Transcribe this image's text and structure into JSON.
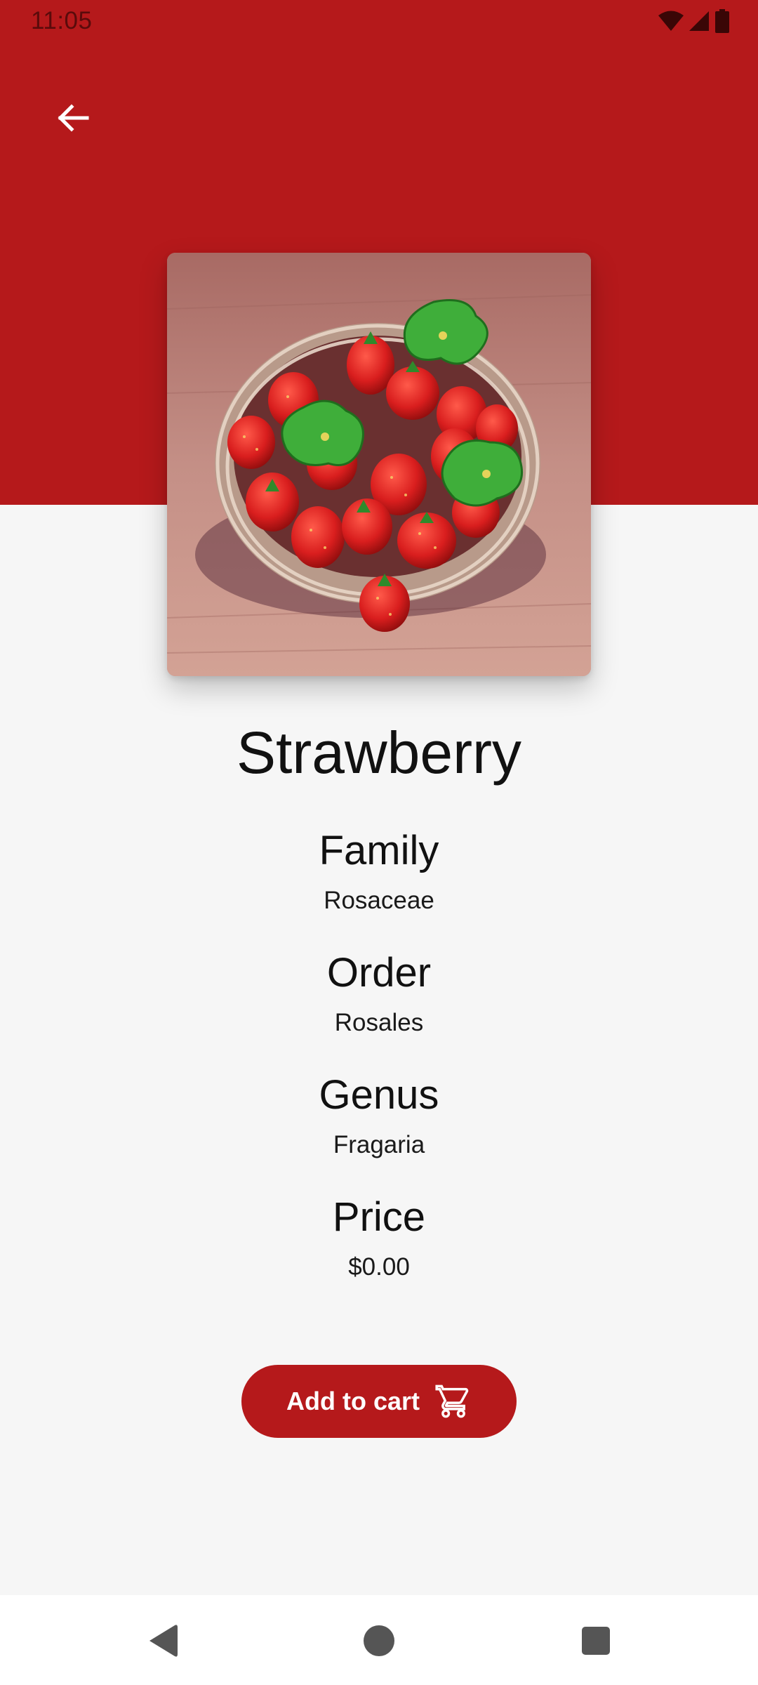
{
  "status_bar": {
    "time": "11:05",
    "icons": [
      "wifi-icon",
      "signal-icon",
      "battery-icon"
    ]
  },
  "header": {
    "back_icon": "arrow-back-icon",
    "background_color": "#b5191b"
  },
  "product": {
    "name": "Strawberry",
    "details": [
      {
        "label": "Family",
        "value": "Rosaceae"
      },
      {
        "label": "Order",
        "value": "Rosales"
      },
      {
        "label": "Genus",
        "value": "Fragaria"
      },
      {
        "label": "Price",
        "value": "$0.00"
      }
    ]
  },
  "actions": {
    "add_to_cart_label": "Add to cart",
    "cart_icon": "shopping-cart-icon"
  },
  "nav_bar": {
    "buttons": [
      "back-triangle-icon",
      "home-circle-icon",
      "recents-square-icon"
    ]
  },
  "colors": {
    "accent": "#b5191b",
    "background": "#f6f6f6"
  }
}
